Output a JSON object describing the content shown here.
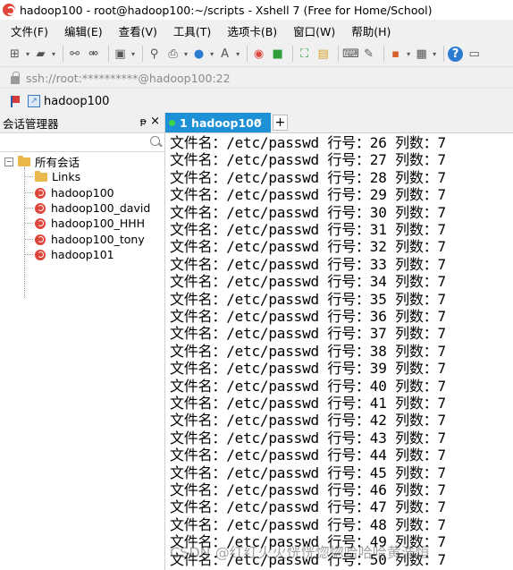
{
  "window": {
    "title": "hadoop100 - root@hadoop100:~/scripts - Xshell 7 (Free for Home/School)"
  },
  "menu": [
    "文件(F)",
    "编辑(E)",
    "查看(V)",
    "工具(T)",
    "选项卡(B)",
    "窗口(W)",
    "帮助(H)"
  ],
  "address": {
    "text": "ssh://root:**********@hadoop100:22"
  },
  "links_bar": {
    "item": "hadoop100"
  },
  "sidebar": {
    "title": "会话管理器",
    "pin": "ᵽ",
    "close": "×",
    "root": "所有会话",
    "items": [
      "Links",
      "hadoop100",
      "hadoop100_david",
      "hadoop100_HHH",
      "hadoop100_tony",
      "hadoop101"
    ]
  },
  "tabs": {
    "active_label": "1 hadoop100",
    "close": "×",
    "add": "+"
  },
  "terminal": {
    "lines": [
      "文件名：/etc/passwd 行号：26 列数：7",
      "文件名：/etc/passwd 行号：27 列数：7",
      "文件名：/etc/passwd 行号：28 列数：7",
      "文件名：/etc/passwd 行号：29 列数：7",
      "文件名：/etc/passwd 行号：30 列数：7",
      "文件名：/etc/passwd 行号：31 列数：7",
      "文件名：/etc/passwd 行号：32 列数：7",
      "文件名：/etc/passwd 行号：33 列数：7",
      "文件名：/etc/passwd 行号：34 列数：7",
      "文件名：/etc/passwd 行号：35 列数：7",
      "文件名：/etc/passwd 行号：36 列数：7",
      "文件名：/etc/passwd 行号：37 列数：7",
      "文件名：/etc/passwd 行号：38 列数：7",
      "文件名：/etc/passwd 行号：39 列数：7",
      "文件名：/etc/passwd 行号：40 列数：7",
      "文件名：/etc/passwd 行号：41 列数：7",
      "文件名：/etc/passwd 行号：42 列数：7",
      "文件名：/etc/passwd 行号：43 列数：7",
      "文件名：/etc/passwd 行号：44 列数：7",
      "文件名：/etc/passwd 行号：45 列数：7",
      "文件名：/etc/passwd 行号：46 列数：7",
      "文件名：/etc/passwd 行号：47 列数：7",
      "文件名：/etc/passwd 行号：48 列数：7",
      "文件名：/etc/passwd 行号：49 列数：7",
      "文件名：/etc/passwd 行号：50 列数：7"
    ]
  },
  "watermark": "CSDN @红红火火恍恍惚惚哈哈哈黄浩恒",
  "colors": {
    "tab_active": "#1e90d6",
    "session_icon": "#e0453b",
    "status_dot": "#38d84a"
  }
}
